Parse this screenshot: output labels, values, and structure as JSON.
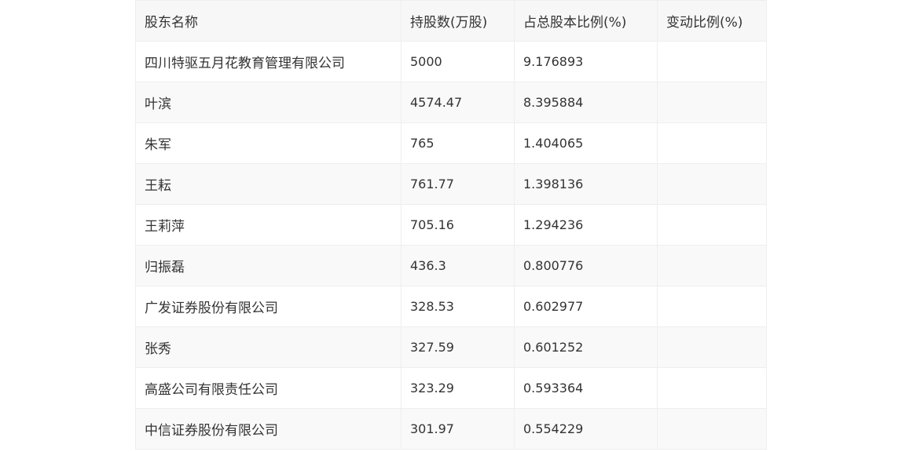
{
  "table": {
    "headers": [
      "股东名称",
      "持股数(万股)",
      "占总股本比例(%)",
      "变动比例(%)"
    ],
    "rows": [
      {
        "name": "四川特驱五月花教育管理有限公司",
        "shares": "5000",
        "ratio": "9.176893",
        "change": ""
      },
      {
        "name": "叶滨",
        "shares": "4574.47",
        "ratio": "8.395884",
        "change": ""
      },
      {
        "name": "朱军",
        "shares": "765",
        "ratio": "1.404065",
        "change": ""
      },
      {
        "name": "王耘",
        "shares": "761.77",
        "ratio": "1.398136",
        "change": ""
      },
      {
        "name": "王莉萍",
        "shares": "705.16",
        "ratio": "1.294236",
        "change": ""
      },
      {
        "name": "归振磊",
        "shares": "436.3",
        "ratio": "0.800776",
        "change": ""
      },
      {
        "name": "广发证券股份有限公司",
        "shares": "328.53",
        "ratio": "0.602977",
        "change": ""
      },
      {
        "name": "张秀",
        "shares": "327.59",
        "ratio": "0.601252",
        "change": ""
      },
      {
        "name": "高盛公司有限责任公司",
        "shares": "323.29",
        "ratio": "0.593364",
        "change": ""
      },
      {
        "name": "中信证券股份有限公司",
        "shares": "301.97",
        "ratio": "0.554229",
        "change": ""
      }
    ]
  }
}
